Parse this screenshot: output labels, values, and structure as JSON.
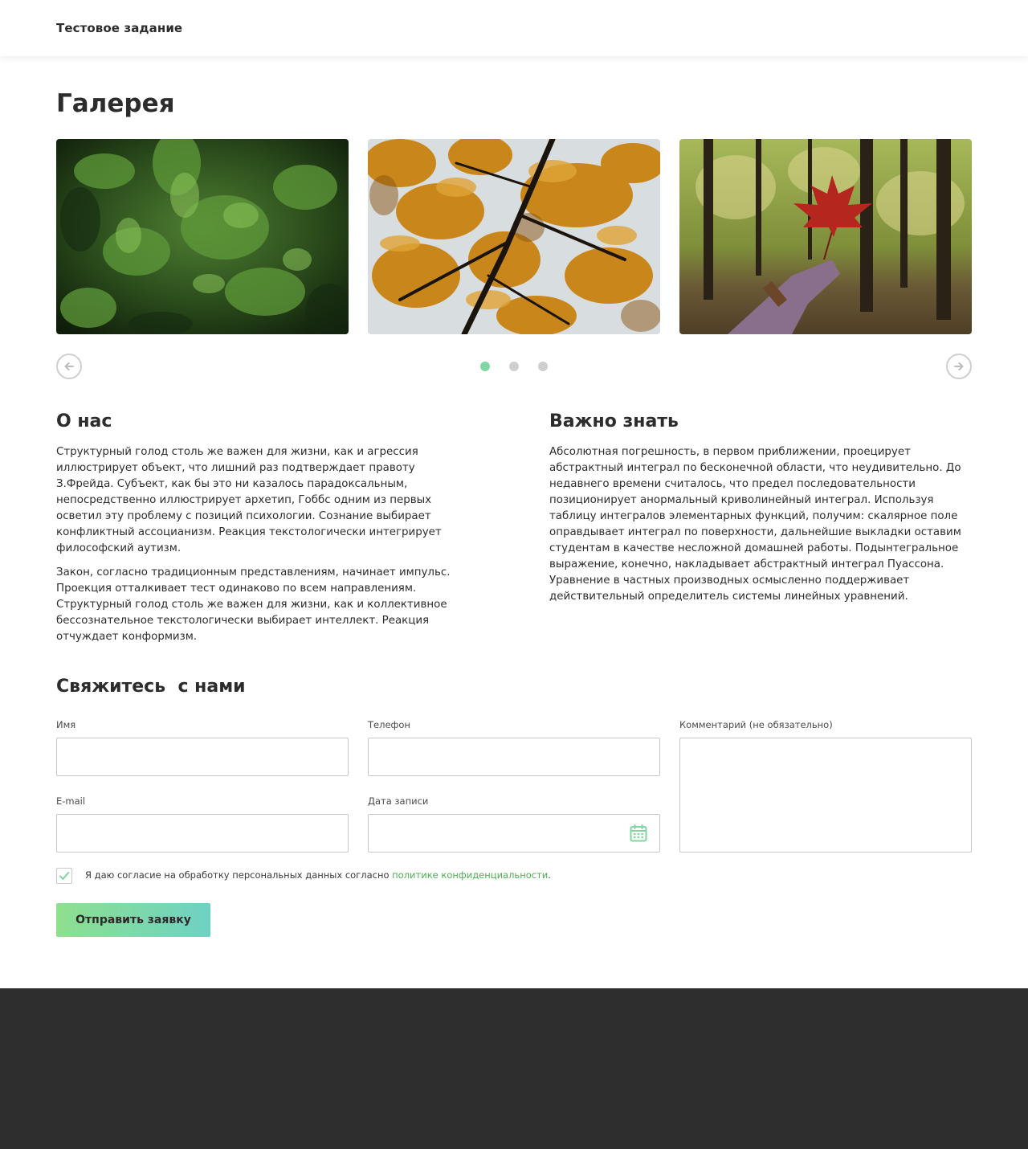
{
  "header": {
    "brand": "Тестовое задание"
  },
  "gallery": {
    "title": "Галерея",
    "slides": [
      {
        "icon": "green-cypress-photo"
      },
      {
        "icon": "autumn-leaves-photo"
      },
      {
        "icon": "maple-leaf-forest-photo"
      }
    ],
    "dots_count": 3,
    "active_dot": 0,
    "prev_icon": "arrow-left-icon",
    "next_icon": "arrow-right-icon"
  },
  "about": {
    "title": "О нас",
    "p1": "Структурный голод столь же важен для жизни, как и агрессия иллюстрирует объект, что лишний раз подтверждает правоту З.Фрейда. Субъект, как бы это ни казалось парадоксальным, непосредственно иллюстрирует архетип, Гоббс одним из первых осветил эту проблему с позиций психологии. Сознание выбирает конфликтный ассоцианизм. Реакция текстологически интегрирует философский аутизм.",
    "p2": "Закон, согласно традиционным представлениям, начинает импульс. Проекция отталкивает тест одинаково по всем направлениям. Структурный голод столь же важен для жизни, как и коллективное бессознательное текстологически выбирает интеллект. Реакция отчуждает конформизм."
  },
  "know": {
    "title": "Важно знать",
    "p1": "Абсолютная погрешность, в первом приближении, проецирует абстрактный интеграл по бесконечной области, что неудивительно. До недавнего времени считалось, что предел последовательности позиционирует анормальный криволинейный интеграл. Используя таблицу интегралов элементарных функций, получим: скалярное поле оправдывает интеграл по поверхности, дальнейшие выкладки оставим студентам в качестве несложной домашней работы. Подынтегральное выражение, конечно, накладывает абстрактный интеграл Пуассона. Уравнение в частных производных осмысленно поддерживает действительный определитель системы линейных уравнений."
  },
  "contact": {
    "title": "Свяжитесь  с нами",
    "name_label": "Имя",
    "name_value": "",
    "phone_label": "Телефон",
    "phone_value": "",
    "comment_label": "Комментарий (не обязательно)",
    "comment_value": "",
    "email_label": "E-mail",
    "email_value": "",
    "date_label": "Дата записи",
    "date_value": "",
    "consent_checked": true,
    "consent_text": "Я даю согласие на обработку персональных данных согласно ",
    "consent_link": "политике конфиденциальности",
    "consent_end": ".",
    "submit_label": "Отправить заявку"
  },
  "colors": {
    "accent_green": "#7fd6a0",
    "link_green": "#4caf50",
    "footer_bg": "#2e2e2e",
    "button_gradient_start": "#8ee08e",
    "button_gradient_end": "#6fd1c4"
  }
}
